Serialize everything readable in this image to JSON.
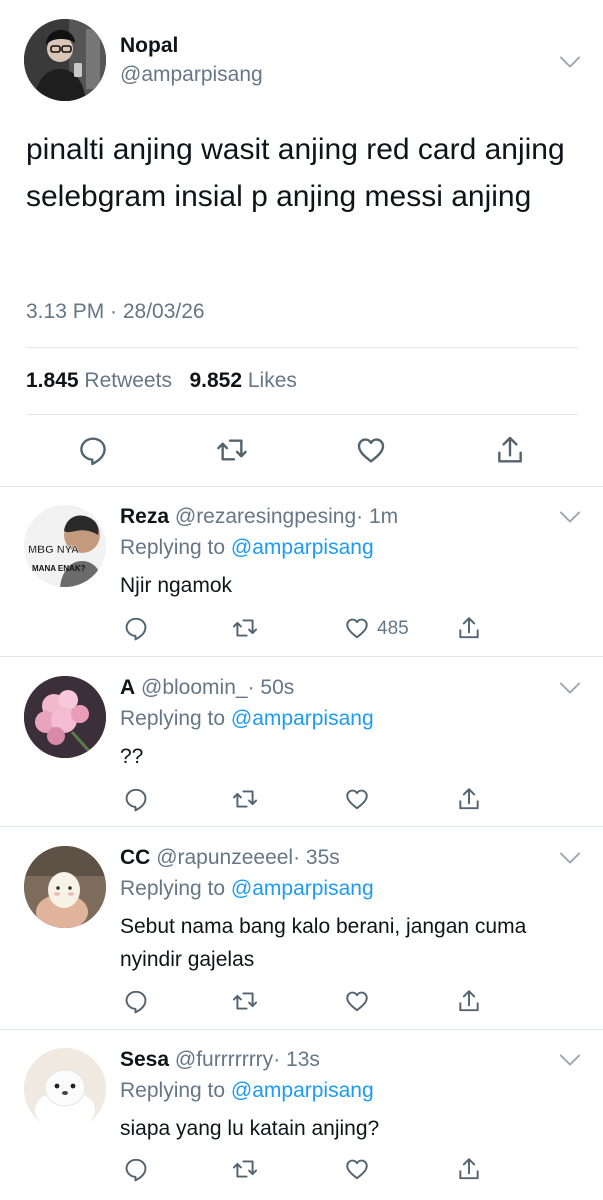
{
  "tweet": {
    "name": "Nopal",
    "handle": "@amparpisang",
    "text": "pinalti anjing wasit anjing red card anjing selebgram insial p anjing messi anjing",
    "timestamp": "3.13 PM · 28/03/26",
    "retweets_count": "1.845",
    "retweets_label": "Retweets",
    "likes_count": "9.852",
    "likes_label": "Likes"
  },
  "replies": [
    {
      "name": "Reza",
      "handle": "@rezaresingpesing",
      "time": "· 1m",
      "replying_prefix": "Replying to",
      "replying_to": "@amparpisang",
      "text": "Njir ngamok",
      "likes": "485",
      "avatar_caption_top": "MBG NYA",
      "avatar_caption_bottom": "MANA ENAK?"
    },
    {
      "name": "A",
      "handle": "@bloomin_",
      "time": "· 50s",
      "replying_prefix": "Replying to",
      "replying_to": "@amparpisang",
      "text": "??",
      "likes": ""
    },
    {
      "name": "CC",
      "handle": "@rapunzeeeel",
      "time": "· 35s",
      "replying_prefix": "Replying to",
      "replying_to": "@amparpisang",
      "text": "Sebut nama bang kalo berani, jangan cuma nyindir gajelas",
      "likes": ""
    },
    {
      "name": "Sesa",
      "handle": "@furrrrrrry",
      "time": "· 13s",
      "replying_prefix": "Replying to",
      "replying_to": "@amparpisang",
      "text": "siapa yang lu katain anjing?",
      "likes": ""
    }
  ],
  "colors": {
    "text": "#0f1419",
    "secondary": "#657786",
    "link": "#1d9bf0",
    "divider": "#e1e8ed"
  },
  "icons": [
    "chevron-down-icon",
    "reply-icon",
    "retweet-icon",
    "like-icon",
    "share-icon"
  ]
}
